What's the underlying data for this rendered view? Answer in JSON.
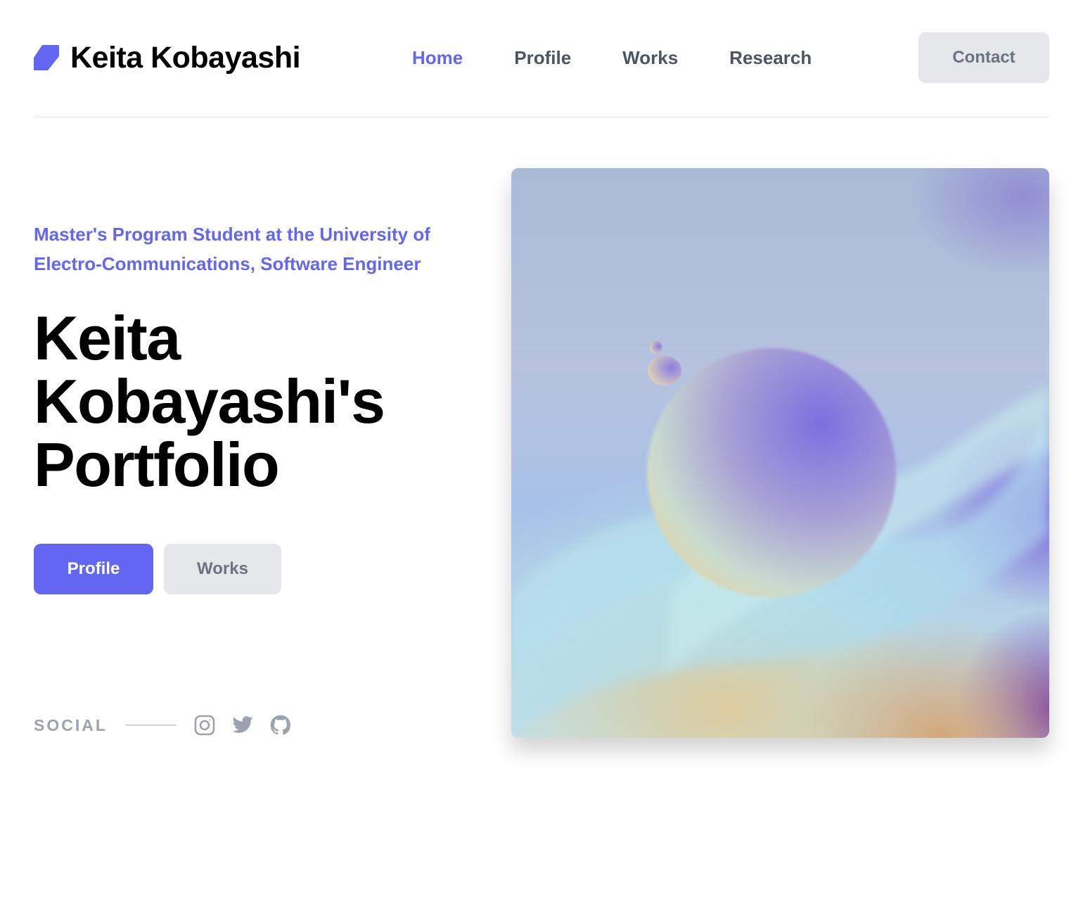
{
  "header": {
    "brand_name": "Keita Kobayashi",
    "brand_icon": "logo-parallelogram-icon",
    "nav": [
      {
        "label": "Home",
        "active": true
      },
      {
        "label": "Profile",
        "active": false
      },
      {
        "label": "Works",
        "active": false
      },
      {
        "label": "Research",
        "active": false
      }
    ],
    "contact_label": "Contact"
  },
  "hero": {
    "subtitle": "Master's Program Student at the University of Electro-Communications, Software Engineer",
    "title": "Keita Kobayashi's Portfolio",
    "buttons": {
      "primary_label": "Profile",
      "secondary_label": "Works"
    },
    "image_icon": "abstract-sphere-illustration"
  },
  "social": {
    "label": "SOCIAL",
    "icons": [
      "instagram-icon",
      "twitter-icon",
      "github-icon"
    ]
  },
  "colors": {
    "accent": "#6366f1",
    "nav_text": "#4b5563",
    "button_gray": "#e5e7eb",
    "muted_text": "#9ca3af"
  }
}
